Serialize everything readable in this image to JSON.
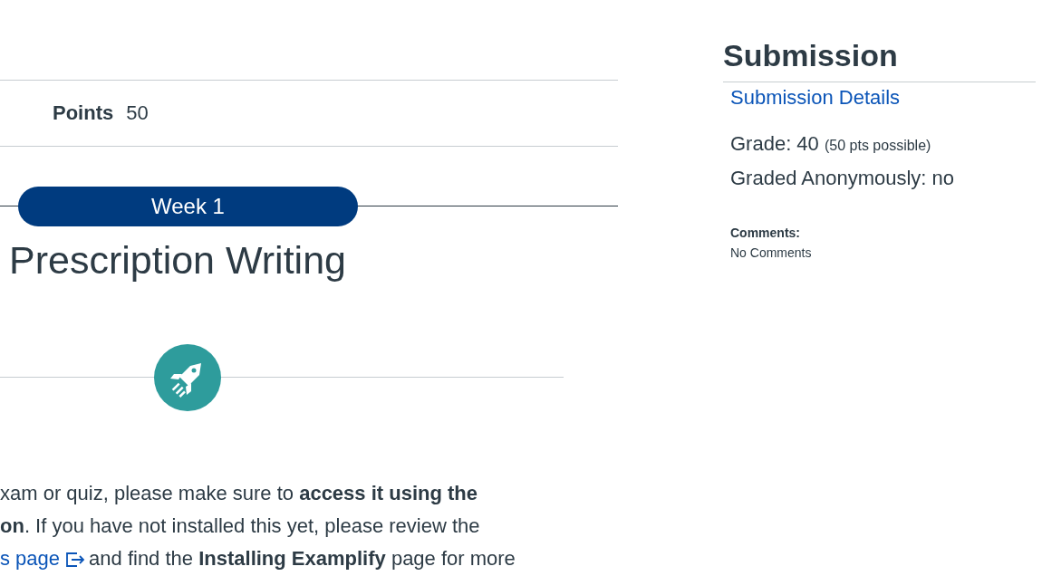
{
  "details": {
    "points_label": "Points",
    "points_value": "50"
  },
  "module": {
    "week_label": "Week 1",
    "title": "Prescription Writing"
  },
  "paragraph": {
    "line_1": "xam or quiz, please make sure to **access it using the**",
    "line_2": "**on**. If you have not installed this yet, please review the",
    "link": "s page",
    "line_3": "and find the **Installing Examplify** page for more"
  },
  "sidebar": {
    "title": "Submission",
    "details_link": "Submission Details",
    "grade": "Grade: 40",
    "grade_possible": "(50 pts possible)",
    "anonymous": "Graded Anonymously: no",
    "comments_label": "Comments:",
    "comments": "No Comments"
  }
}
